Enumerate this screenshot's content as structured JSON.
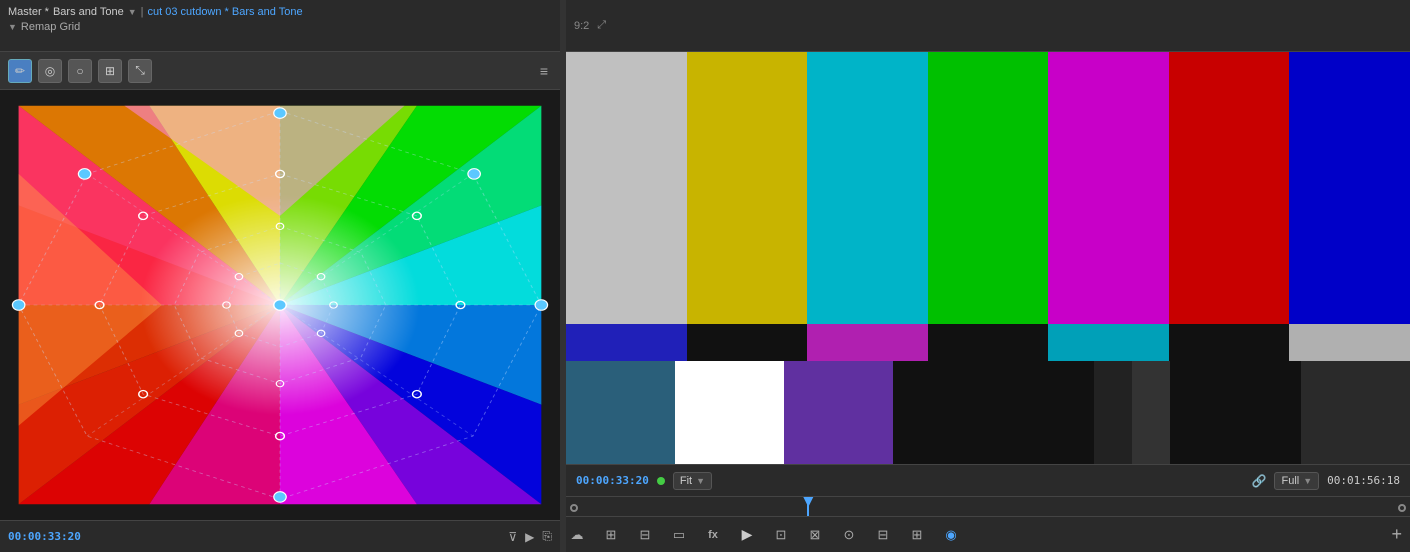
{
  "header": {
    "master_label": "Master *",
    "bars_tone_label": "Bars and Tone",
    "cut_label": "cut 03 cutdown * Bars and Tone",
    "remap_grid_label": "Remap Grid",
    "chevron_down": "▼",
    "arrow_right": "▶",
    "expand_icon": "⤢"
  },
  "toolbar": {
    "tools": [
      {
        "id": "pen",
        "symbol": "✏",
        "active": true
      },
      {
        "id": "circle",
        "symbol": "◎",
        "active": false
      },
      {
        "id": "bulb",
        "symbol": "💡",
        "active": false
      },
      {
        "id": "grid",
        "symbol": "⊞",
        "active": false
      },
      {
        "id": "expand",
        "symbol": "⤡",
        "active": false
      }
    ],
    "menu_icon": "≡"
  },
  "bottom_left": {
    "timecode": "00:00:33:20",
    "filter_icon": "⊽",
    "play_icon": "▶",
    "export_icon": "⎘"
  },
  "video": {
    "timecode_current": "00:00:33:20",
    "timecode_total": "00:01:56:18",
    "fit_label": "Fit",
    "full_label": "Full",
    "timeline_position_pct": 29
  },
  "timeline_header": {
    "position": "9:2",
    "expand_symbol": "⤢"
  },
  "toolbar_bottom": {
    "buttons": [
      {
        "id": "cloud",
        "symbol": "☁",
        "label": "cloud"
      },
      {
        "id": "grid2",
        "symbol": "⊞",
        "label": "grid"
      },
      {
        "id": "align",
        "symbol": "⊟",
        "label": "align"
      },
      {
        "id": "rect",
        "symbol": "▭",
        "label": "rect"
      },
      {
        "id": "fx",
        "symbol": "fx",
        "label": "effects"
      },
      {
        "id": "play",
        "symbol": "▶",
        "label": "play"
      },
      {
        "id": "insert",
        "symbol": "⊡",
        "label": "insert"
      },
      {
        "id": "ripple",
        "symbol": "⊠",
        "label": "ripple"
      },
      {
        "id": "camera",
        "symbol": "⊙",
        "label": "camera"
      },
      {
        "id": "multicam",
        "symbol": "⊟",
        "label": "multicam"
      },
      {
        "id": "overlay",
        "symbol": "⊞",
        "label": "overlay"
      },
      {
        "id": "scope",
        "symbol": "◉",
        "label": "scope"
      }
    ],
    "plus_label": "+"
  },
  "smpte_bars": {
    "top_bars": [
      {
        "color": "#c0c0c0",
        "label": "white"
      },
      {
        "color": "#c8b400",
        "label": "yellow"
      },
      {
        "color": "#00b4c8",
        "label": "cyan"
      },
      {
        "color": "#00b400",
        "label": "green"
      },
      {
        "color": "#c800c8",
        "label": "magenta"
      },
      {
        "color": "#c80000",
        "label": "red"
      },
      {
        "color": "#0000c8",
        "label": "blue"
      }
    ],
    "middle_bars": [
      {
        "color": "#0000c8",
        "label": "blue"
      },
      {
        "color": "#111111",
        "label": "black"
      },
      {
        "color": "#c800c8",
        "label": "magenta"
      },
      {
        "color": "#111111",
        "label": "black"
      },
      {
        "color": "#00b4c8",
        "label": "cyan"
      },
      {
        "color": "#111111",
        "label": "black"
      },
      {
        "color": "#c0c0c0",
        "label": "white"
      }
    ],
    "bottom_sections": [
      {
        "color": "#2a5f7a",
        "flex": 1
      },
      {
        "color": "#ffffff",
        "flex": 1
      },
      {
        "color": "#6030a0",
        "flex": 1
      },
      {
        "color": "#111111",
        "flex": 1.5
      },
      {
        "color": "#111111",
        "flex": 0.4
      },
      {
        "color": "#222222",
        "flex": 0.4
      },
      {
        "color": "#333333",
        "flex": 0.4
      },
      {
        "color": "#111111",
        "flex": 1.2
      },
      {
        "color": "#2a2a2a",
        "flex": 1
      }
    ]
  }
}
